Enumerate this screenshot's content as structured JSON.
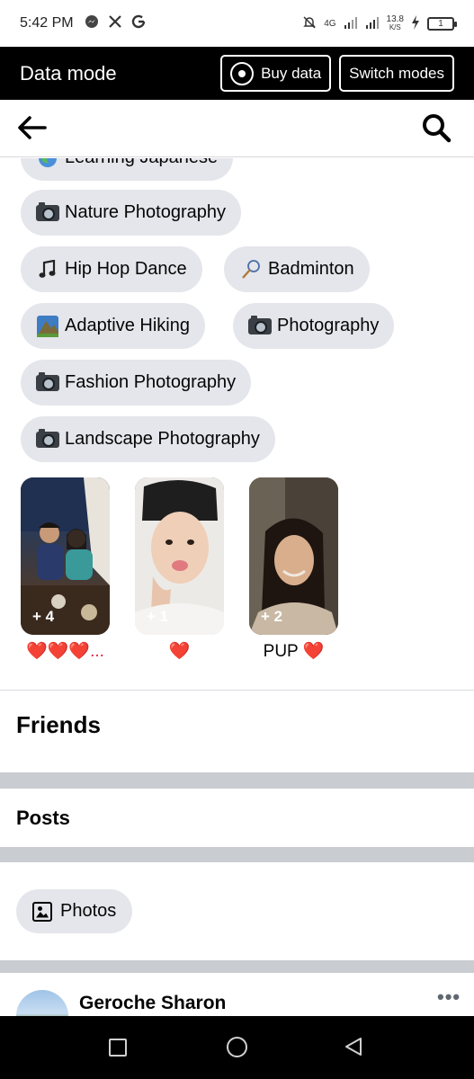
{
  "status_bar": {
    "time": "5:42 PM",
    "left_icons": [
      "messenger-icon",
      "x-icon",
      "google-icon"
    ],
    "network": "4G",
    "speed_value": "13.8",
    "speed_unit": "K/S",
    "battery": "1"
  },
  "data_mode": {
    "title": "Data mode",
    "buy_label": "Buy data",
    "switch_label": "Switch modes"
  },
  "nav": {
    "back_icon": "arrow-left-icon",
    "search_icon": "search-icon"
  },
  "hobbies": [
    {
      "emoji": "globe-icon",
      "label": "Learning Japanese"
    },
    {
      "emoji": "camera-icon",
      "label": "Nature Photography"
    },
    {
      "emoji": "music-note-icon",
      "label": "Hip Hop Dance"
    },
    {
      "emoji": "badminton-icon",
      "label": "Badminton"
    },
    {
      "emoji": "mountain-icon",
      "label": "Adaptive Hiking"
    },
    {
      "emoji": "camera-icon",
      "label": "Photography"
    },
    {
      "emoji": "camera-icon",
      "label": "Fashion Photography"
    },
    {
      "emoji": "camera-icon",
      "label": "Landscape Photography"
    }
  ],
  "featured": [
    {
      "count": "+ 4",
      "caption": "❤️❤️❤️..."
    },
    {
      "count": "+ 1",
      "caption": "❤️"
    },
    {
      "count": "+ 2",
      "caption": "PUP ❤️"
    }
  ],
  "sections": {
    "friends": "Friends",
    "posts": "Posts",
    "photos": "Photos"
  },
  "post": {
    "author": "Geroche Sharon",
    "more": "•••"
  },
  "colors": {
    "chip_bg": "#e4e6eb",
    "heart": "#e41e3f",
    "band": "#c9ccd1"
  }
}
